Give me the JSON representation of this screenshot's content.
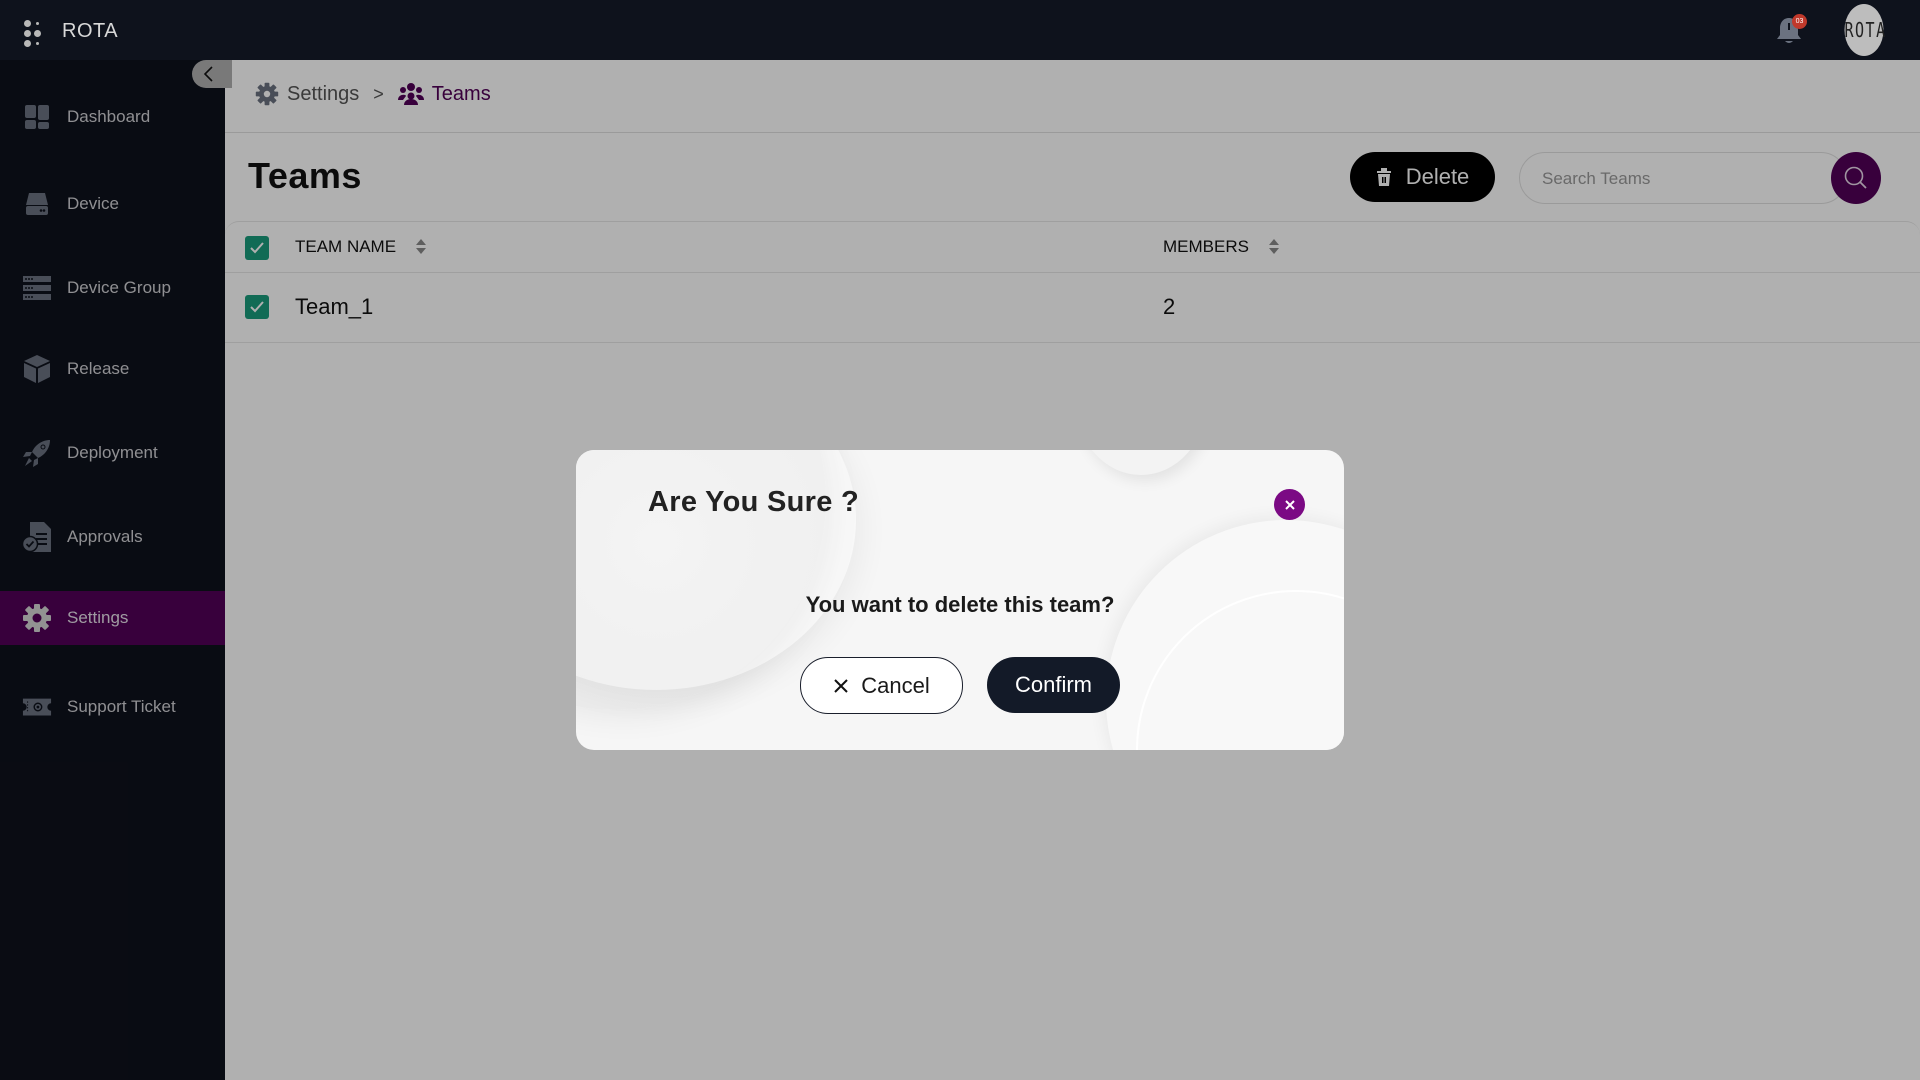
{
  "app": {
    "title": "ROTA",
    "notification_count": "03",
    "avatar_text": "ROTA"
  },
  "colors": {
    "brand_purple": "#520057",
    "checkbox_green": "#1a9c7c",
    "sidebar_bg": "#0e121c",
    "close_button": "#7b0a84",
    "notification_badge": "#c0392b"
  },
  "sidebar": {
    "items": [
      {
        "label": "Dashboard",
        "icon": "dashboard-icon",
        "active": false
      },
      {
        "label": "Device",
        "icon": "device-icon",
        "active": false
      },
      {
        "label": "Device Group",
        "icon": "device-group-icon",
        "active": false
      },
      {
        "label": "Release",
        "icon": "release-box-icon",
        "active": false
      },
      {
        "label": "Deployment",
        "icon": "rocket-icon",
        "active": false
      },
      {
        "label": "Approvals",
        "icon": "approvals-icon",
        "active": false
      },
      {
        "label": "Settings",
        "icon": "gear-icon",
        "active": true
      },
      {
        "label": "Support Ticket",
        "icon": "ticket-icon",
        "active": false
      }
    ]
  },
  "breadcrumb": {
    "items": [
      {
        "label": "Settings",
        "icon": "gear-icon"
      },
      {
        "label": "Teams",
        "icon": "users-icon"
      }
    ],
    "separator": ">"
  },
  "page": {
    "title": "Teams",
    "delete_label": "Delete",
    "search_placeholder": "Search Teams",
    "search_value": ""
  },
  "table": {
    "columns": [
      {
        "label": "TEAM NAME",
        "sortable": true
      },
      {
        "label": "MEMBERS",
        "sortable": true
      }
    ],
    "select_all_checked": true,
    "rows": [
      {
        "team_name": "Team_1",
        "members": "2",
        "checked": true
      }
    ]
  },
  "modal": {
    "title": "Are You Sure ?",
    "message": "You want to delete this team?",
    "cancel_label": "Cancel",
    "confirm_label": "Confirm"
  }
}
